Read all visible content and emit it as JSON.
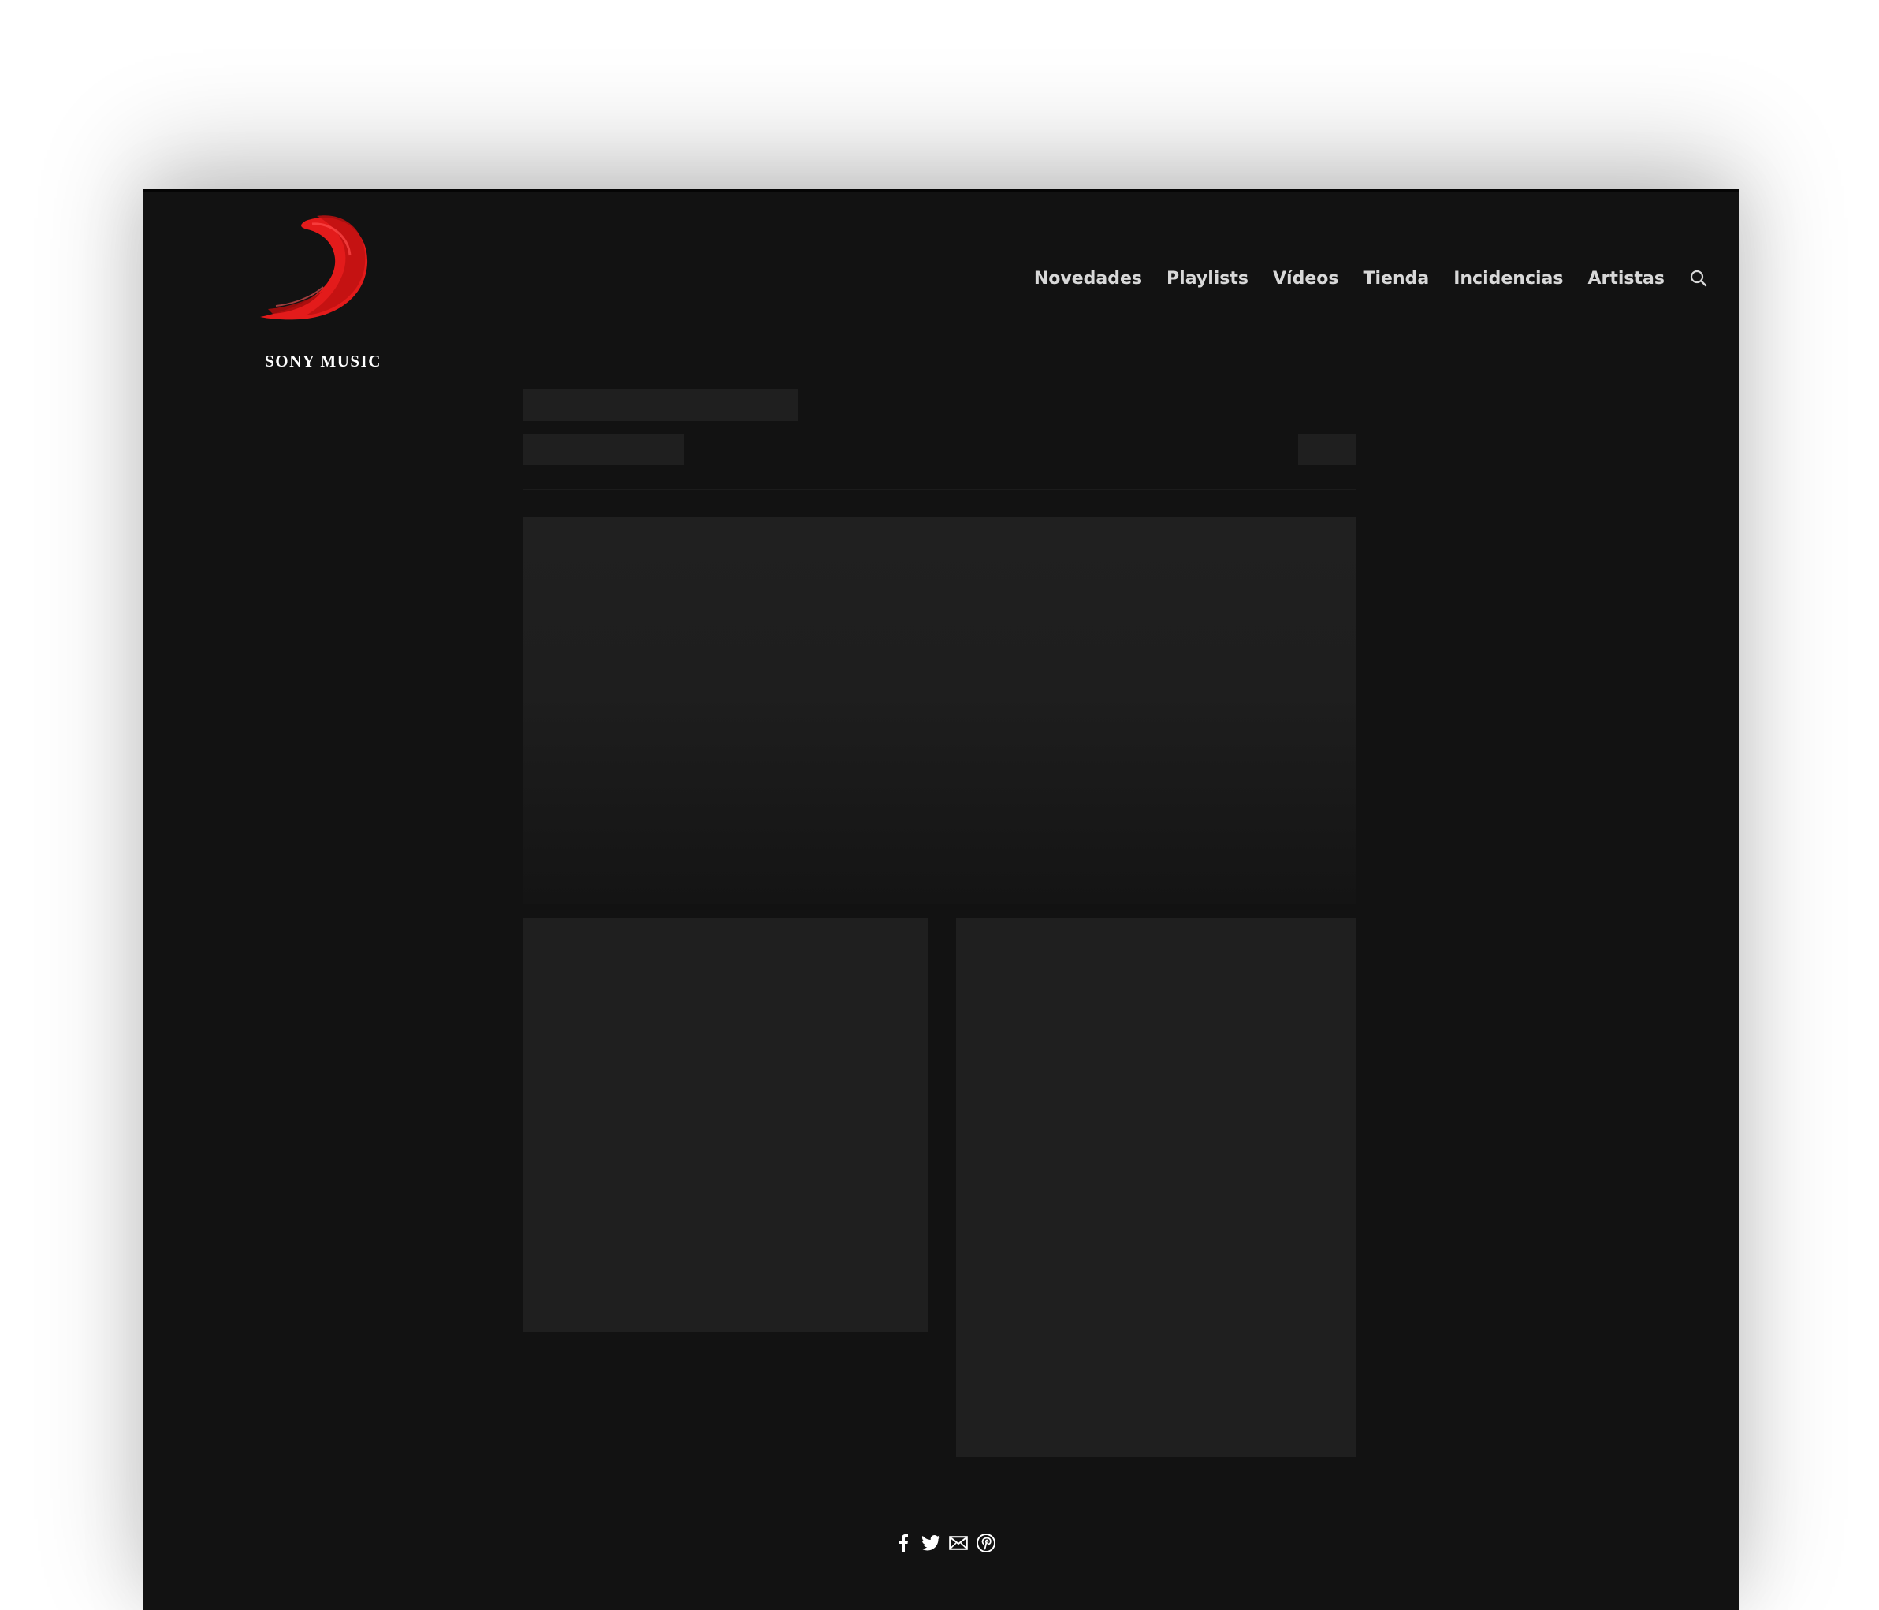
{
  "brand": {
    "name": "SONY MUSIC",
    "logo_color": "#e31b1b"
  },
  "nav": {
    "items": [
      {
        "label": "Novedades"
      },
      {
        "label": "Playlists"
      },
      {
        "label": "Vídeos"
      },
      {
        "label": "Tienda"
      },
      {
        "label": "Incidencias"
      },
      {
        "label": "Artistas"
      }
    ],
    "search_icon": "search-icon"
  },
  "share": {
    "icons": [
      "facebook-icon",
      "twitter-icon",
      "email-icon",
      "pinterest-icon"
    ]
  },
  "colors": {
    "background": "#121212",
    "skeleton": "#1f1f1f",
    "nav_text": "#d8d8d8"
  }
}
